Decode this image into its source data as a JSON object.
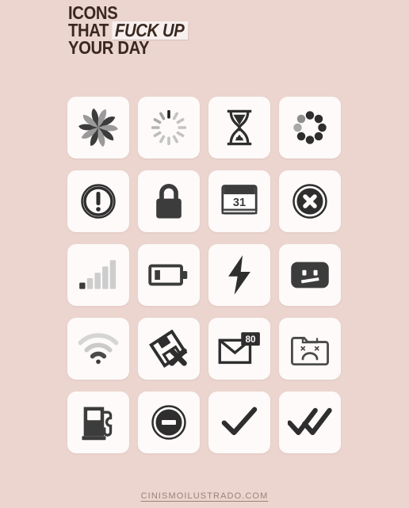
{
  "title": {
    "line1": "ICONS",
    "line2_prefix": "THAT",
    "line2_highlight": "FUCK UP",
    "line3": "YOUR DAY"
  },
  "colors": {
    "background": "#ecd5cf",
    "card": "#fdfaf9",
    "ink": "#3a2820",
    "icon_dark": "#3c3c3c",
    "icon_gray": "#b4b4b4",
    "footer": "#9d8078",
    "highlight_bg": "#f7f0ee"
  },
  "grid": {
    "columns": 4,
    "rows": 5,
    "icons": [
      {
        "name": "beachball-spinner-icon",
        "label": "Spinning beachball"
      },
      {
        "name": "spoke-spinner-icon",
        "label": "Spoke loading spinner"
      },
      {
        "name": "hourglass-icon",
        "label": "Hourglass"
      },
      {
        "name": "dot-spinner-icon",
        "label": "Dot ring spinner"
      },
      {
        "name": "exclamation-circle-icon",
        "label": "Warning exclamation"
      },
      {
        "name": "padlock-icon",
        "label": "Locked padlock"
      },
      {
        "name": "calendar-icon",
        "label": "Calendar",
        "badge": "31"
      },
      {
        "name": "x-circle-icon",
        "label": "Error cross"
      },
      {
        "name": "signal-bars-icon",
        "label": "Low signal bars"
      },
      {
        "name": "low-battery-icon",
        "label": "Low battery"
      },
      {
        "name": "lightning-bolt-icon",
        "label": "Lightning bolt"
      },
      {
        "name": "sad-screen-icon",
        "label": "Unhappy screen face"
      },
      {
        "name": "weak-wifi-icon",
        "label": "Weak wifi"
      },
      {
        "name": "broken-save-icon",
        "label": "Save failed disk"
      },
      {
        "name": "envelope-badge-icon",
        "label": "Unread mail",
        "badge": "80"
      },
      {
        "name": "sad-folder-icon",
        "label": "Dead folder"
      },
      {
        "name": "fuel-pump-icon",
        "label": "Fuel pump"
      },
      {
        "name": "no-entry-icon",
        "label": "Blocked / no entry"
      },
      {
        "name": "check-single-icon",
        "label": "Single checkmark"
      },
      {
        "name": "check-double-icon",
        "label": "Double checkmark"
      }
    ]
  },
  "footer": {
    "link": "CINISMOILUSTRADO.COM"
  }
}
